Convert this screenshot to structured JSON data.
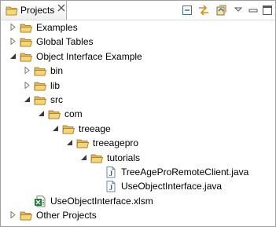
{
  "view": {
    "tab_title": "Projects",
    "tab_icon": "projects-folder-icon",
    "toolbar": [
      "collapse-all-icon",
      "link-with-editor-icon",
      "sync-icon",
      "view-menu-chevron-icon",
      "minimize-icon",
      "maximize-icon"
    ]
  },
  "tree": [
    {
      "label": "Examples",
      "level": 0,
      "twisty": "collapsed",
      "icon": "folder-icon"
    },
    {
      "label": "Global Tables",
      "level": 0,
      "twisty": "collapsed",
      "icon": "folder-icon"
    },
    {
      "label": "Object Interface Example",
      "level": 0,
      "twisty": "expanded",
      "icon": "folder-icon"
    },
    {
      "label": "bin",
      "level": 1,
      "twisty": "collapsed",
      "icon": "folder-icon"
    },
    {
      "label": "lib",
      "level": 1,
      "twisty": "collapsed",
      "icon": "folder-icon"
    },
    {
      "label": "src",
      "level": 1,
      "twisty": "expanded",
      "icon": "folder-icon"
    },
    {
      "label": "com",
      "level": 2,
      "twisty": "expanded",
      "icon": "folder-icon"
    },
    {
      "label": "treeage",
      "level": 3,
      "twisty": "expanded",
      "icon": "folder-icon"
    },
    {
      "label": "treeagepro",
      "level": 4,
      "twisty": "expanded",
      "icon": "folder-icon"
    },
    {
      "label": "tutorials",
      "level": 5,
      "twisty": "expanded",
      "icon": "folder-icon"
    },
    {
      "label": "TreeAgeProRemoteClient.java",
      "level": 6,
      "twisty": "none",
      "icon": "java-file-icon"
    },
    {
      "label": "UseObjectInterface.java",
      "level": 6,
      "twisty": "none",
      "icon": "java-file-icon"
    },
    {
      "label": "UseObjectInterface.xlsm",
      "level": 1,
      "twisty": "none",
      "icon": "excel-file-icon"
    },
    {
      "label": "Other Projects",
      "level": 0,
      "twisty": "collapsed",
      "icon": "folder-icon"
    }
  ]
}
